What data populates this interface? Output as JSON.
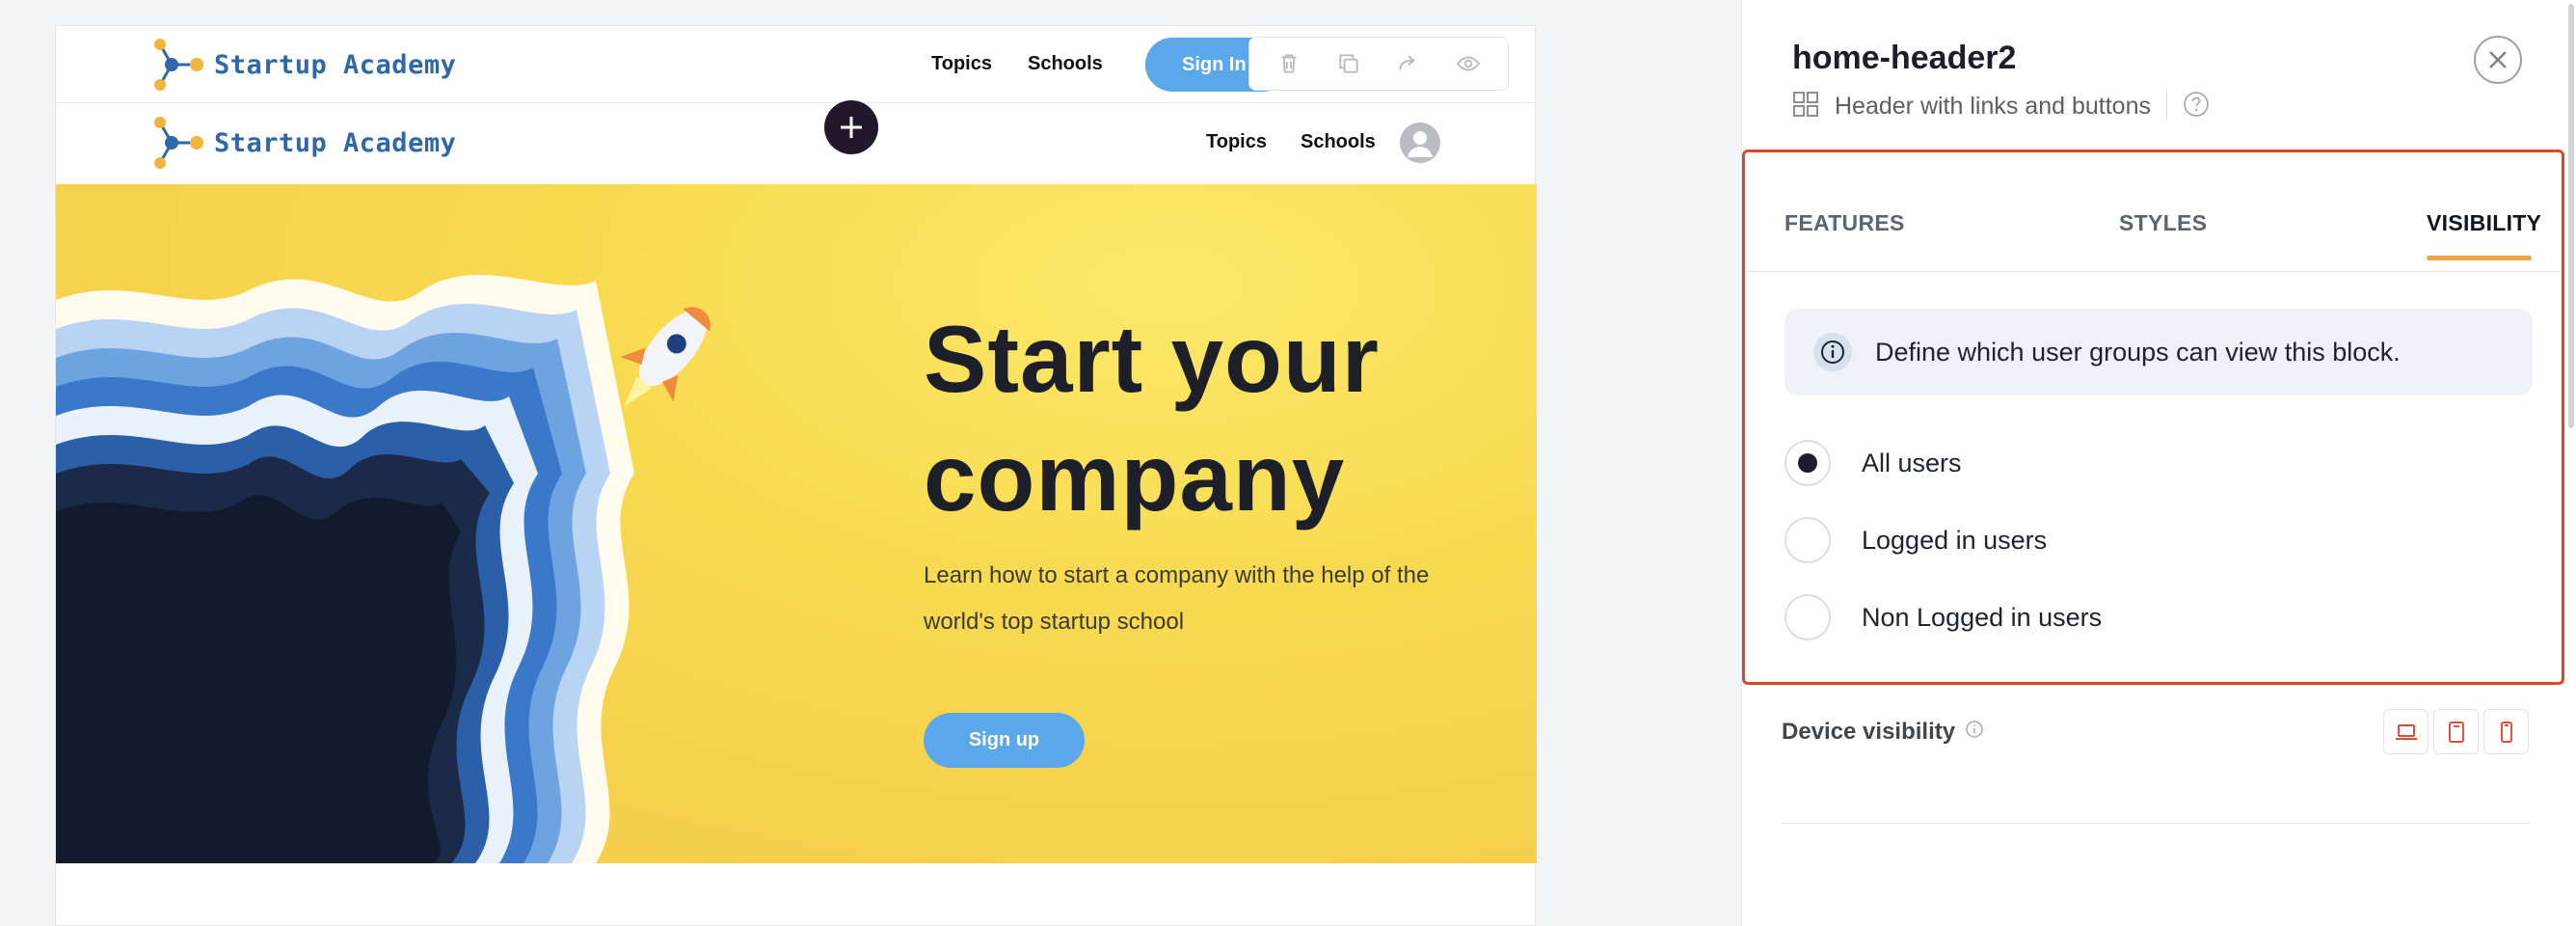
{
  "canvas": {
    "header_top": {
      "logo_text": "Startup Academy",
      "nav": [
        "Topics",
        "Schools"
      ],
      "signin_label": "Sign In"
    },
    "toolbar": {
      "icons": [
        "trash-icon",
        "duplicate-icon",
        "forward-icon",
        "eye-icon"
      ]
    },
    "header_second": {
      "logo_text": "Startup Academy",
      "nav": [
        "Topics",
        "Schools"
      ]
    },
    "hero": {
      "title": "Start your company",
      "subtitle": "Learn how to start a company with the help of the world's top startup school",
      "cta": "Sign up"
    }
  },
  "panel": {
    "block_name": "home-header2",
    "block_description": "Header with links and buttons",
    "tabs": [
      {
        "label": "FEATURES",
        "active": false
      },
      {
        "label": "STYLES",
        "active": false
      },
      {
        "label": "VISIBILITY",
        "active": true
      }
    ],
    "info_text": "Define which user groups can view this block.",
    "visibility_options": [
      {
        "label": "All users",
        "selected": true
      },
      {
        "label": "Logged in users",
        "selected": false
      },
      {
        "label": "Non Logged in users",
        "selected": false
      }
    ],
    "device_visibility_label": "Device visibility",
    "devices": [
      "laptop-icon",
      "tablet-icon",
      "phone-icon"
    ]
  },
  "colors": {
    "accent_blue": "#5aa7e9",
    "hero_yellow": "#f8d94e",
    "highlight_red": "#e0452c",
    "tab_underline": "#eea440",
    "dark": "#221a2e"
  }
}
